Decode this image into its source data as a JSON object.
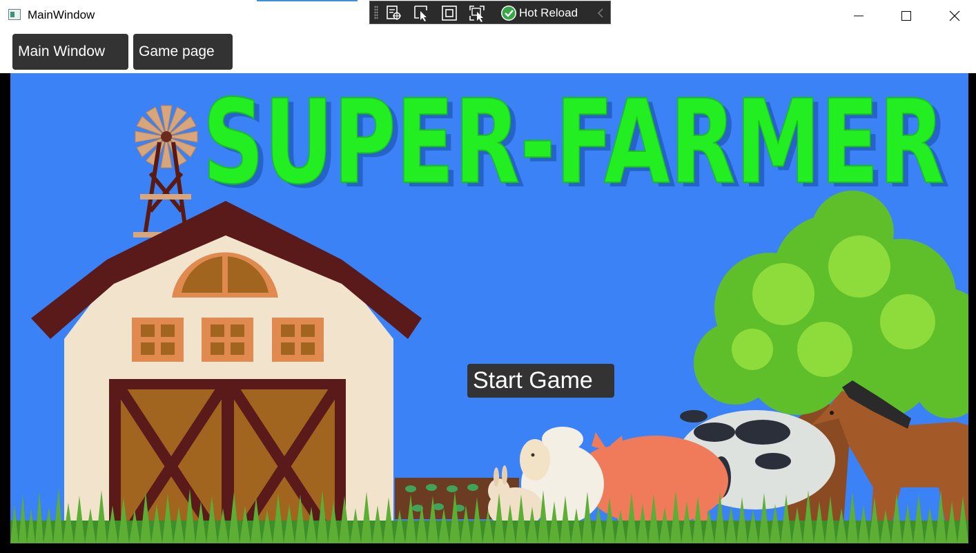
{
  "window": {
    "title": "MainWindow",
    "minimize_icon": "minimize-icon",
    "maximize_icon": "maximize-icon",
    "close_icon": "close-icon"
  },
  "devtoolbar": {
    "hot_reload_label": "Hot Reload",
    "icons": [
      "live-visual-tree-icon",
      "select-element-icon",
      "display-layout-adorners-icon",
      "track-focus-icon",
      "hot-reload-check-icon",
      "collapse-chevron-icon"
    ]
  },
  "nav": {
    "main_window_label": "Main Window",
    "game_page_label": "Game page"
  },
  "game": {
    "title": "SUPER-FARMER",
    "start_button_label": "Start Game",
    "colors": {
      "sky": "#3b82f6",
      "title": "#22ee22",
      "title_shadow": "#2563c8",
      "button_bg": "#333333"
    }
  }
}
